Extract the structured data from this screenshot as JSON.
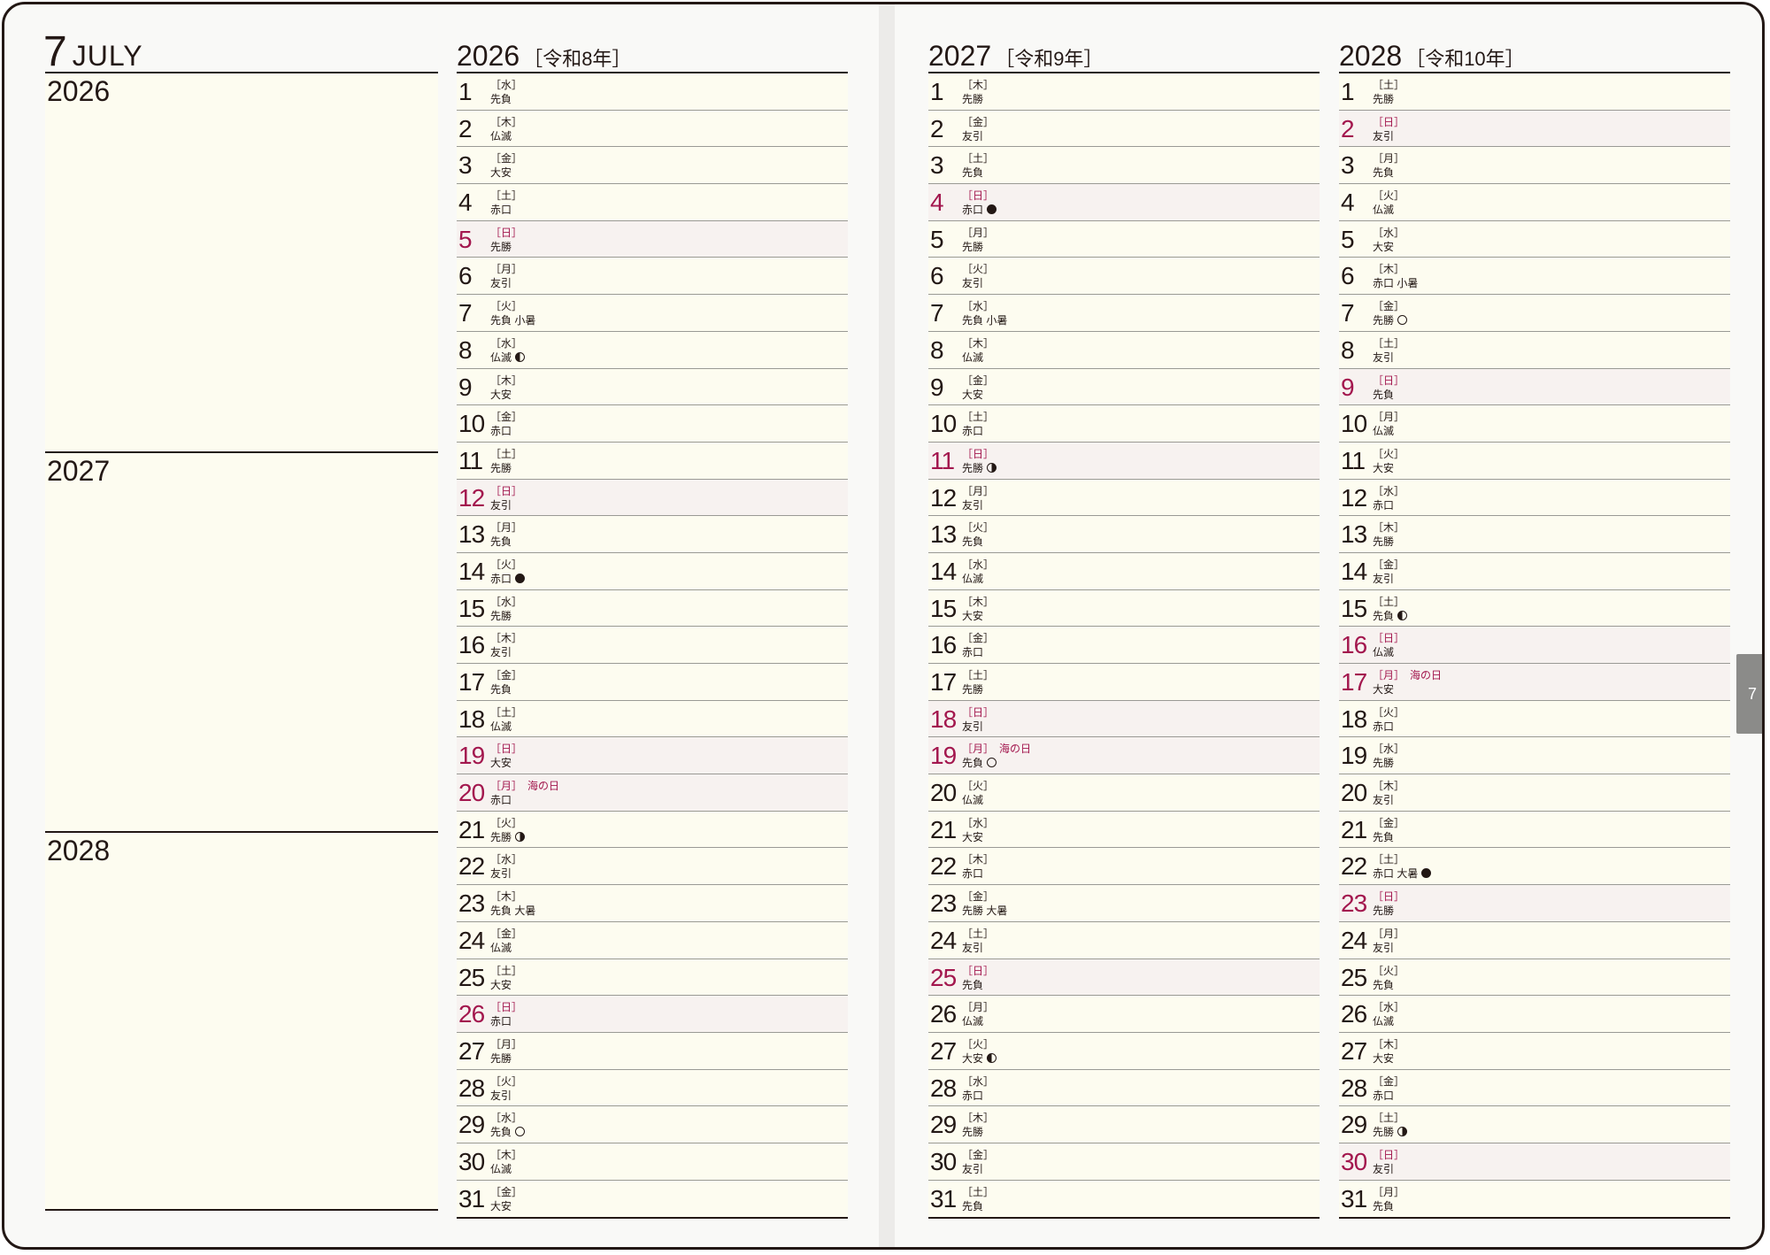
{
  "header": {
    "month_number": "7",
    "month_name": "JULY"
  },
  "memo_years": [
    "2026",
    "2027",
    "2028"
  ],
  "tab": {
    "label": "7"
  },
  "columns": [
    {
      "year": "2026",
      "era": "［令和8年］",
      "days": [
        {
          "d": "1",
          "wd": "［水］",
          "rk": "先負"
        },
        {
          "d": "2",
          "wd": "［木］",
          "rk": "仏滅"
        },
        {
          "d": "3",
          "wd": "［金］",
          "rk": "大安"
        },
        {
          "d": "4",
          "wd": "［土］",
          "rk": "赤口"
        },
        {
          "d": "5",
          "wd": "［日］",
          "rk": "先勝",
          "sun": true
        },
        {
          "d": "6",
          "wd": "［月］",
          "rk": "友引"
        },
        {
          "d": "7",
          "wd": "［火］",
          "rk": "先負",
          "note": "小暑"
        },
        {
          "d": "8",
          "wd": "［水］",
          "rk": "仏滅",
          "moon": "last-quarter"
        },
        {
          "d": "9",
          "wd": "［木］",
          "rk": "大安"
        },
        {
          "d": "10",
          "wd": "［金］",
          "rk": "赤口"
        },
        {
          "d": "11",
          "wd": "［土］",
          "rk": "先勝"
        },
        {
          "d": "12",
          "wd": "［日］",
          "rk": "友引",
          "sun": true
        },
        {
          "d": "13",
          "wd": "［月］",
          "rk": "先負"
        },
        {
          "d": "14",
          "wd": "［火］",
          "rk": "赤口",
          "moon": "new"
        },
        {
          "d": "15",
          "wd": "［水］",
          "rk": "先勝"
        },
        {
          "d": "16",
          "wd": "［木］",
          "rk": "友引"
        },
        {
          "d": "17",
          "wd": "［金］",
          "rk": "先負"
        },
        {
          "d": "18",
          "wd": "［土］",
          "rk": "仏滅"
        },
        {
          "d": "19",
          "wd": "［日］",
          "rk": "大安",
          "sun": true
        },
        {
          "d": "20",
          "wd": "［月］",
          "rk": "赤口",
          "sun": true,
          "holiday": "海の日"
        },
        {
          "d": "21",
          "wd": "［火］",
          "rk": "先勝",
          "moon": "first-quarter"
        },
        {
          "d": "22",
          "wd": "［水］",
          "rk": "友引"
        },
        {
          "d": "23",
          "wd": "［木］",
          "rk": "先負",
          "note": "大暑"
        },
        {
          "d": "24",
          "wd": "［金］",
          "rk": "仏滅"
        },
        {
          "d": "25",
          "wd": "［土］",
          "rk": "大安"
        },
        {
          "d": "26",
          "wd": "［日］",
          "rk": "赤口",
          "sun": true
        },
        {
          "d": "27",
          "wd": "［月］",
          "rk": "先勝"
        },
        {
          "d": "28",
          "wd": "［火］",
          "rk": "友引"
        },
        {
          "d": "29",
          "wd": "［水］",
          "rk": "先負",
          "moon": "full"
        },
        {
          "d": "30",
          "wd": "［木］",
          "rk": "仏滅"
        },
        {
          "d": "31",
          "wd": "［金］",
          "rk": "大安"
        }
      ]
    },
    {
      "year": "2027",
      "era": "［令和9年］",
      "days": [
        {
          "d": "1",
          "wd": "［木］",
          "rk": "先勝"
        },
        {
          "d": "2",
          "wd": "［金］",
          "rk": "友引"
        },
        {
          "d": "3",
          "wd": "［土］",
          "rk": "先負"
        },
        {
          "d": "4",
          "wd": "［日］",
          "rk": "赤口",
          "sun": true,
          "moon": "new"
        },
        {
          "d": "5",
          "wd": "［月］",
          "rk": "先勝"
        },
        {
          "d": "6",
          "wd": "［火］",
          "rk": "友引"
        },
        {
          "d": "7",
          "wd": "［水］",
          "rk": "先負",
          "note": "小暑"
        },
        {
          "d": "8",
          "wd": "［木］",
          "rk": "仏滅"
        },
        {
          "d": "9",
          "wd": "［金］",
          "rk": "大安"
        },
        {
          "d": "10",
          "wd": "［土］",
          "rk": "赤口"
        },
        {
          "d": "11",
          "wd": "［日］",
          "rk": "先勝",
          "sun": true,
          "moon": "first-quarter"
        },
        {
          "d": "12",
          "wd": "［月］",
          "rk": "友引"
        },
        {
          "d": "13",
          "wd": "［火］",
          "rk": "先負"
        },
        {
          "d": "14",
          "wd": "［水］",
          "rk": "仏滅"
        },
        {
          "d": "15",
          "wd": "［木］",
          "rk": "大安"
        },
        {
          "d": "16",
          "wd": "［金］",
          "rk": "赤口"
        },
        {
          "d": "17",
          "wd": "［土］",
          "rk": "先勝"
        },
        {
          "d": "18",
          "wd": "［日］",
          "rk": "友引",
          "sun": true
        },
        {
          "d": "19",
          "wd": "［月］",
          "rk": "先負",
          "sun": true,
          "holiday": "海の日",
          "moon": "full"
        },
        {
          "d": "20",
          "wd": "［火］",
          "rk": "仏滅"
        },
        {
          "d": "21",
          "wd": "［水］",
          "rk": "大安"
        },
        {
          "d": "22",
          "wd": "［木］",
          "rk": "赤口"
        },
        {
          "d": "23",
          "wd": "［金］",
          "rk": "先勝",
          "note": "大暑"
        },
        {
          "d": "24",
          "wd": "［土］",
          "rk": "友引"
        },
        {
          "d": "25",
          "wd": "［日］",
          "rk": "先負",
          "sun": true
        },
        {
          "d": "26",
          "wd": "［月］",
          "rk": "仏滅"
        },
        {
          "d": "27",
          "wd": "［火］",
          "rk": "大安",
          "moon": "last-quarter"
        },
        {
          "d": "28",
          "wd": "［水］",
          "rk": "赤口"
        },
        {
          "d": "29",
          "wd": "［木］",
          "rk": "先勝"
        },
        {
          "d": "30",
          "wd": "［金］",
          "rk": "友引"
        },
        {
          "d": "31",
          "wd": "［土］",
          "rk": "先負"
        }
      ]
    },
    {
      "year": "2028",
      "era": "［令和10年］",
      "days": [
        {
          "d": "1",
          "wd": "［土］",
          "rk": "先勝"
        },
        {
          "d": "2",
          "wd": "［日］",
          "rk": "友引",
          "sun": true
        },
        {
          "d": "3",
          "wd": "［月］",
          "rk": "先負"
        },
        {
          "d": "4",
          "wd": "［火］",
          "rk": "仏滅"
        },
        {
          "d": "5",
          "wd": "［水］",
          "rk": "大安"
        },
        {
          "d": "6",
          "wd": "［木］",
          "rk": "赤口",
          "note": "小暑"
        },
        {
          "d": "7",
          "wd": "［金］",
          "rk": "先勝",
          "moon": "full"
        },
        {
          "d": "8",
          "wd": "［土］",
          "rk": "友引"
        },
        {
          "d": "9",
          "wd": "［日］",
          "rk": "先負",
          "sun": true
        },
        {
          "d": "10",
          "wd": "［月］",
          "rk": "仏滅"
        },
        {
          "d": "11",
          "wd": "［火］",
          "rk": "大安"
        },
        {
          "d": "12",
          "wd": "［水］",
          "rk": "赤口"
        },
        {
          "d": "13",
          "wd": "［木］",
          "rk": "先勝"
        },
        {
          "d": "14",
          "wd": "［金］",
          "rk": "友引"
        },
        {
          "d": "15",
          "wd": "［土］",
          "rk": "先負",
          "moon": "last-quarter"
        },
        {
          "d": "16",
          "wd": "［日］",
          "rk": "仏滅",
          "sun": true
        },
        {
          "d": "17",
          "wd": "［月］",
          "rk": "大安",
          "sun": true,
          "holiday": "海の日"
        },
        {
          "d": "18",
          "wd": "［火］",
          "rk": "赤口"
        },
        {
          "d": "19",
          "wd": "［水］",
          "rk": "先勝"
        },
        {
          "d": "20",
          "wd": "［木］",
          "rk": "友引"
        },
        {
          "d": "21",
          "wd": "［金］",
          "rk": "先負"
        },
        {
          "d": "22",
          "wd": "［土］",
          "rk": "赤口",
          "note": "大暑",
          "moon": "new"
        },
        {
          "d": "23",
          "wd": "［日］",
          "rk": "先勝",
          "sun": true
        },
        {
          "d": "24",
          "wd": "［月］",
          "rk": "友引"
        },
        {
          "d": "25",
          "wd": "［火］",
          "rk": "先負"
        },
        {
          "d": "26",
          "wd": "［水］",
          "rk": "仏滅"
        },
        {
          "d": "27",
          "wd": "［木］",
          "rk": "大安"
        },
        {
          "d": "28",
          "wd": "［金］",
          "rk": "赤口"
        },
        {
          "d": "29",
          "wd": "［土］",
          "rk": "先勝",
          "moon": "first-quarter"
        },
        {
          "d": "30",
          "wd": "［日］",
          "rk": "友引",
          "sun": true
        },
        {
          "d": "31",
          "wd": "［月］",
          "rk": "先負"
        }
      ]
    }
  ]
}
